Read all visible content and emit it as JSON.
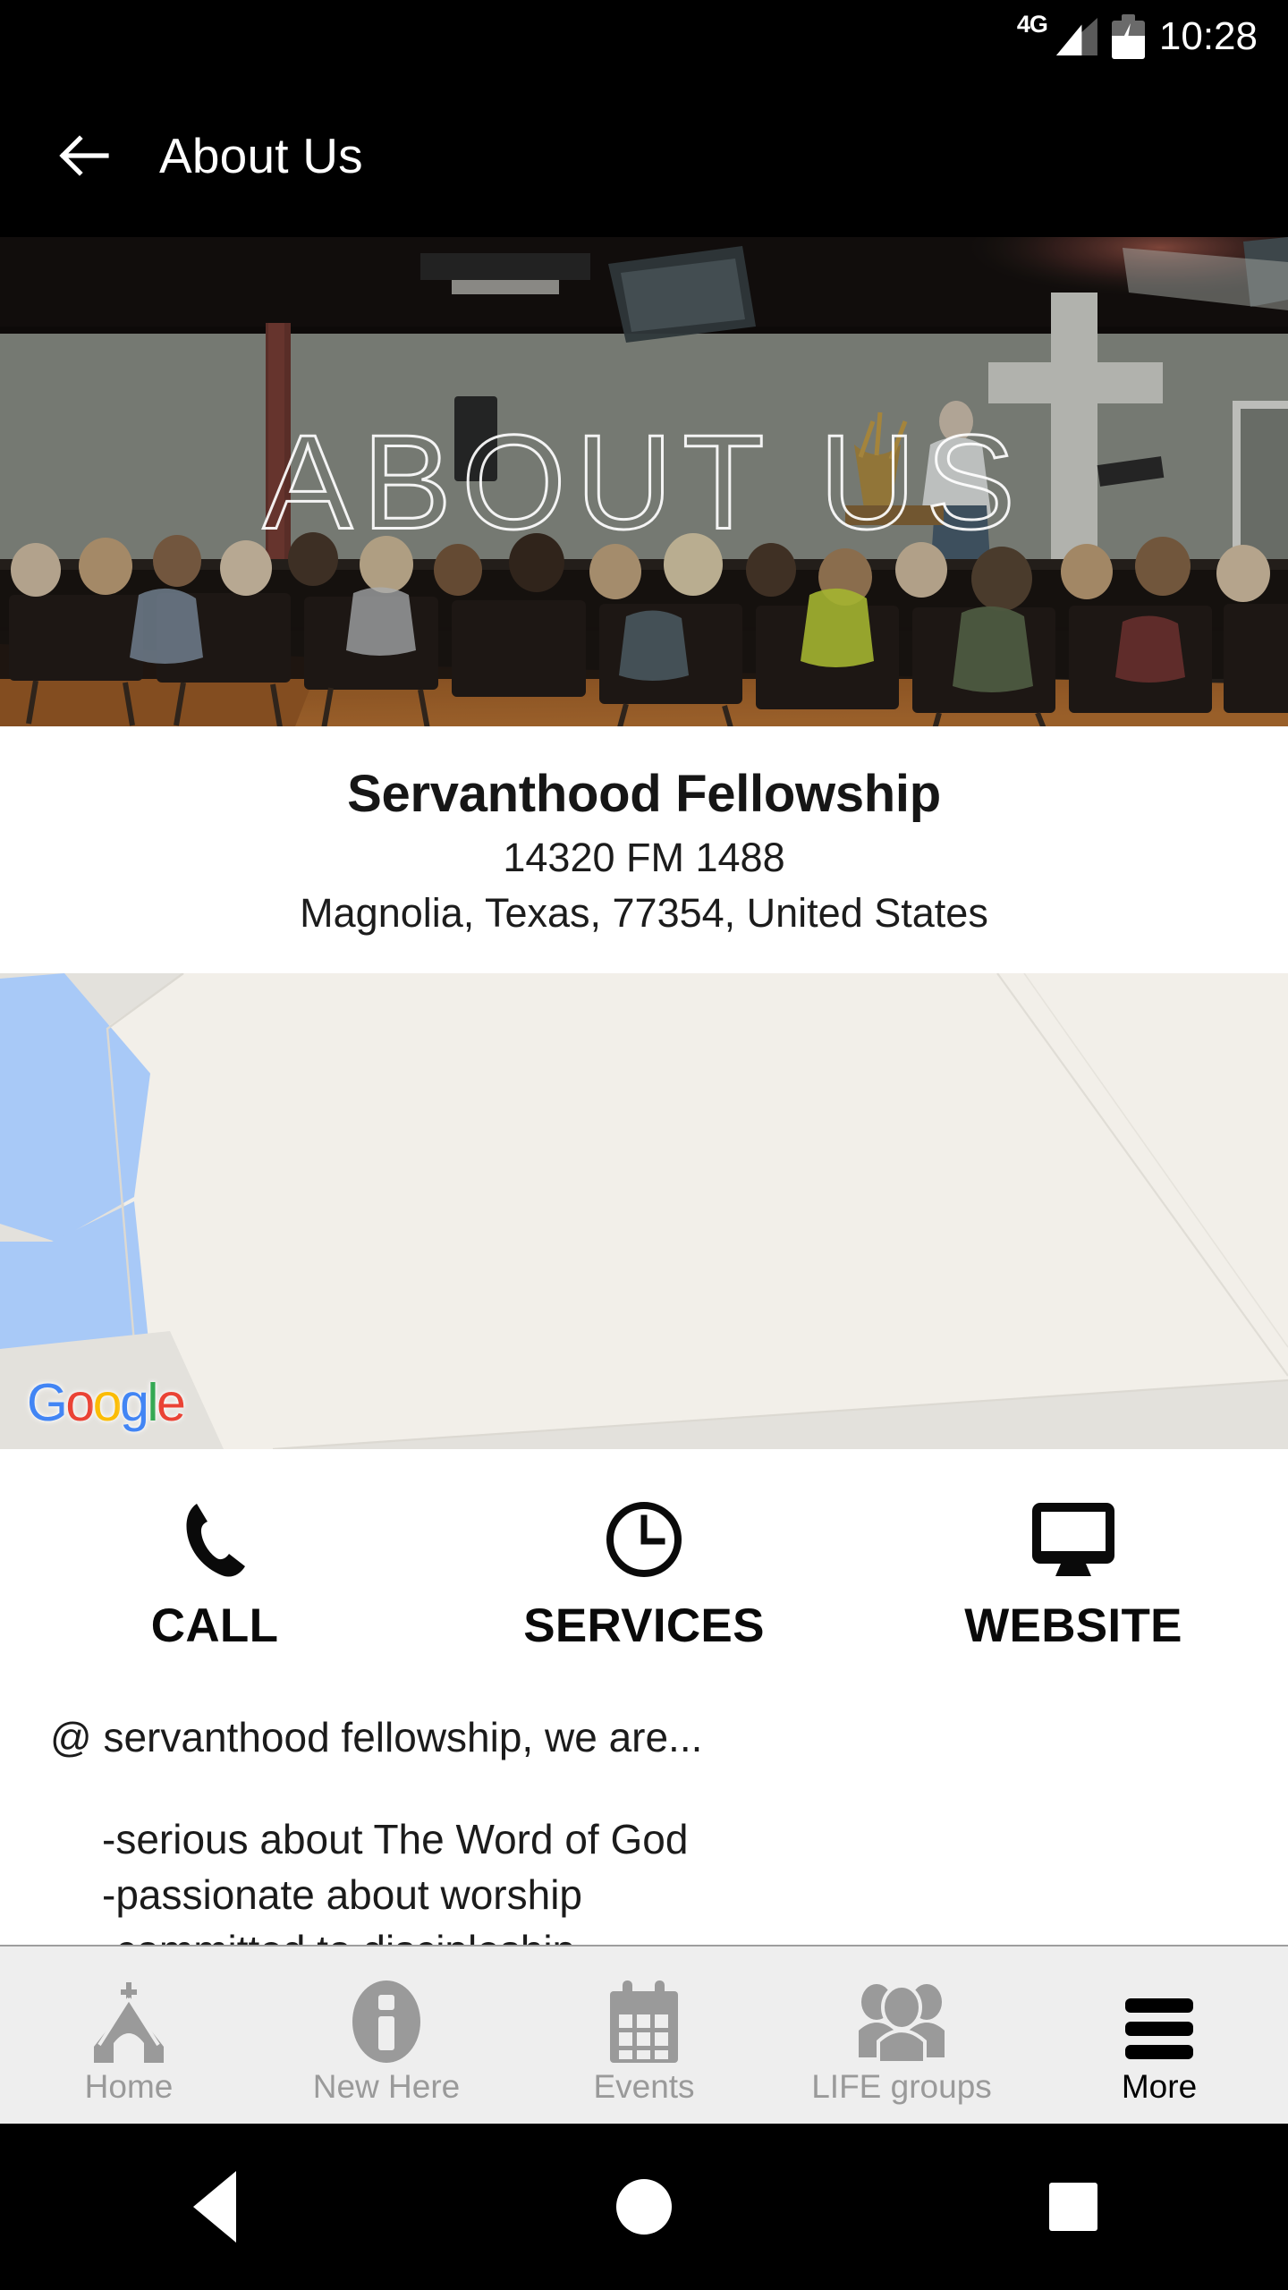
{
  "status_bar": {
    "network_label": "4G",
    "time": "10:28",
    "signal_icon": "signal-bars-icon",
    "battery_icon": "battery-charging-icon"
  },
  "app_bar": {
    "back_icon": "back-arrow-icon",
    "title": "About Us"
  },
  "hero": {
    "overlay_text": "ABOUT US",
    "description": "church-sanctuary-congregation-photo"
  },
  "organization": {
    "name": "Servanthood Fellowship",
    "address_line1": "14320 FM 1488",
    "address_line2": "Magnolia, Texas, 77354, United States"
  },
  "map": {
    "attribution_letters": [
      "G",
      "o",
      "o",
      "g",
      "l",
      "e"
    ],
    "pin_icon": "map-pin-icon",
    "pin_color": "#ee6e63",
    "land_color": "#f2efe9",
    "water_color": "#a8c9f7",
    "ground_color": "#e2e0db"
  },
  "actions": [
    {
      "label": "CALL",
      "icon": "phone-icon"
    },
    {
      "label": "SERVICES",
      "icon": "clock-icon"
    },
    {
      "label": "WEBSITE",
      "icon": "monitor-icon"
    }
  ],
  "content": {
    "lead": "@ servanthood fellowship, we are...",
    "bullets": [
      "-serious about The Word of God",
      "-passionate about worship",
      "-committed to discipleship"
    ]
  },
  "bottom_nav": {
    "items": [
      {
        "label": "Home",
        "icon": "church-icon",
        "active": false
      },
      {
        "label": "New Here",
        "icon": "info-icon",
        "active": false
      },
      {
        "label": "Events",
        "icon": "calendar-icon",
        "active": false
      },
      {
        "label": "LIFE groups",
        "icon": "people-icon",
        "active": false
      },
      {
        "label": "More",
        "icon": "hamburger-menu-icon",
        "active": true
      }
    ]
  },
  "system_nav": {
    "back_icon": "system-back-icon",
    "home_icon": "system-home-icon",
    "recents_icon": "system-recents-icon"
  }
}
